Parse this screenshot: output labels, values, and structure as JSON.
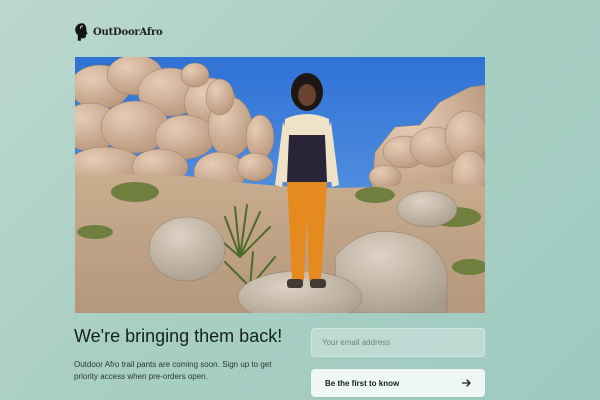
{
  "brand": {
    "name": "OutDoorAfro"
  },
  "hero": {
    "image": "hero-photo",
    "sky_color": "#3f82dc",
    "rock_color": "#d5b59b",
    "jacket_colors": [
      "#efe3c7",
      "#2a2438"
    ],
    "pants_color": "#e58a1f"
  },
  "signup": {
    "headline": "We're bringing them back!",
    "description": "Outdoor Afro trail pants are coming soon. Sign up to get priority access when pre-orders open.",
    "email_placeholder": "Your email address",
    "email_value": "",
    "cta_label": "Be the first to know",
    "cta_icon": "arrow-right-icon"
  },
  "colors": {
    "background": "#add3c9",
    "text": "#16211f",
    "button_bg": "#eef7f4"
  }
}
